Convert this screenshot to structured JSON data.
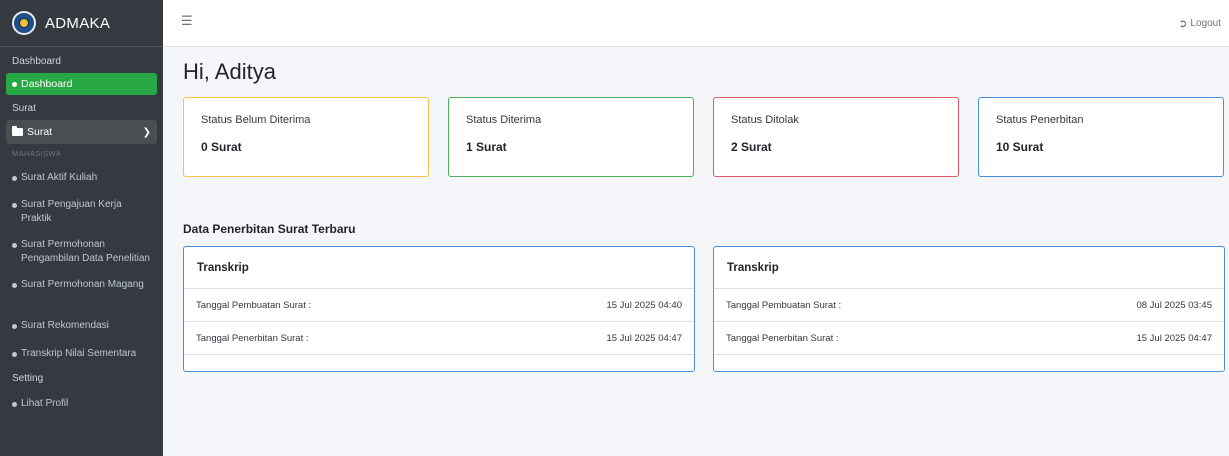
{
  "brand": {
    "name": "ADMAKA"
  },
  "sidebar": {
    "header_dashboard": "Dashboard",
    "item_dashboard": "Dashboard",
    "header_surat": "Surat",
    "tree_surat": "Surat",
    "header_mahasiswa": "MAHASISWA",
    "items": [
      {
        "label": "Surat Aktif Kuliah"
      },
      {
        "label": "Surat Pengajuan Kerja Praktik"
      },
      {
        "label": "Surat Permohonan Pengambilan Data Penelitian"
      },
      {
        "label": "Surat Permohonan Magang"
      },
      {
        "label": "Surat Rekomendasi"
      },
      {
        "label": "Transkrip Nilai Sementara"
      }
    ],
    "header_setting": "Setting",
    "item_profile": "Lihat Profil"
  },
  "topbar": {
    "menu_icon": "hamburger-icon",
    "logout_label": "Logout"
  },
  "main": {
    "greeting": "Hi, Aditya",
    "stats": [
      {
        "label": "Status Belum Diterima",
        "value": "0 Surat",
        "color": "#f5c342"
      },
      {
        "label": "Status Diterima",
        "value": "1 Surat",
        "color": "#4caf60"
      },
      {
        "label": "Status Ditolak",
        "value": "2 Surat",
        "color": "#e05a62"
      },
      {
        "label": "Status Penerbitan",
        "value": "10 Surat",
        "color": "#4a90d9"
      }
    ],
    "section_title": "Data Penerbitan Surat Terbaru",
    "cards": [
      {
        "title": "Transkrip",
        "created_label": "Tanggal Pembuatan Surat :",
        "created_value": "15 Jul 2025 04:40",
        "issued_label": "Tanggal Penerbitan Surat :",
        "issued_value": "15 Jul 2025 04:47"
      },
      {
        "title": "Transkrip",
        "created_label": "Tanggal Pembuatan Surat :",
        "created_value": "08 Jul 2025 03:45",
        "issued_label": "Tanggal Penerbitan Surat :",
        "issued_value": "15 Jul 2025 04:47"
      }
    ]
  }
}
